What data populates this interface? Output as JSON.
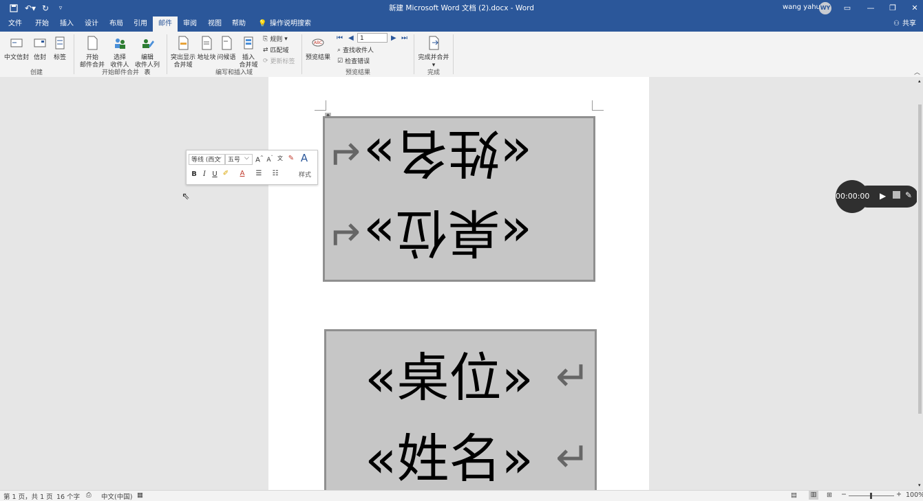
{
  "titlebar": {
    "title": "新建 Microsoft Word 文档 (2).docx  -  Word",
    "user_name": "wang yahui",
    "avatar_initials": "WY"
  },
  "tabs": [
    "文件",
    "开始",
    "插入",
    "设计",
    "布局",
    "引用",
    "邮件",
    "审阅",
    "视图",
    "帮助"
  ],
  "active_tab": "邮件",
  "tell_me": "操作说明搜索",
  "share": "共享",
  "ribbon": {
    "create": {
      "envelopes": "中文信封",
      "envelopes2": "信封",
      "labels": "标签",
      "label": "创建"
    },
    "start": {
      "start_merge_1": "开始",
      "start_merge_2": "邮件合并",
      "select_1": "选择",
      "select_2": "收件人",
      "edit_1": "编辑",
      "edit_2": "收件人列表",
      "label": "开始邮件合并"
    },
    "write": {
      "highlight_1": "突出显示",
      "highlight_2": "合并域",
      "address": "地址块",
      "greeting": "问候语",
      "insert_1": "插入",
      "insert_2": "合并域",
      "rules": "规则",
      "match": "匹配域",
      "update": "更新标签",
      "label": "编写和插入域"
    },
    "preview": {
      "preview_results": "预览结果",
      "record_number": "1",
      "find_recipient": "查找收件人",
      "check_errors": "检查错误",
      "label": "预览结果"
    },
    "finish": {
      "finish_merge": "完成并合并",
      "label": "完成"
    }
  },
  "document": {
    "box1_line1": "«姓名»",
    "box1_line2": "«桌位»",
    "box2_line1": "«桌位»",
    "box2_line2": "«姓名»",
    "return_mark": "↵"
  },
  "mini_toolbar": {
    "font": "等线 (西文",
    "size": "五号",
    "styles": "样式",
    "bold": "B",
    "italic": "I",
    "underline": "U"
  },
  "recorder": {
    "time": "00:00:00"
  },
  "status": {
    "page": "第 1 页，共 1 页",
    "words": "16 个字",
    "language": "中文(中国)",
    "zoom": "100%"
  }
}
